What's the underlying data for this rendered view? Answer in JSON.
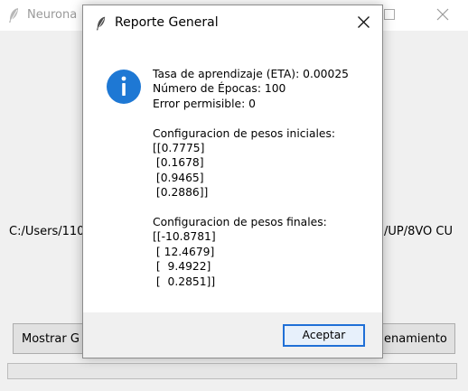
{
  "main_window": {
    "title": "Neurona",
    "path_left": "C:/Users/110",
    "path_right": "/UP/8VO CU",
    "btn_show_label": "Mostrar G",
    "btn_training_label": "enamiento",
    "progress": 0
  },
  "dialog": {
    "title": "Reporte General",
    "message": "Tasa de aprendizaje (ETA): 0.00025\nNúmero de Épocas: 100\nError permisible: 0\n\nConfiguracion de pesos iniciales:\n[[0.7775]\n [0.1678]\n [0.9465]\n [0.2886]]\n\nConfiguracion de pesos finales:\n[[-10.8781]\n [ 12.4679]\n [  9.4922]\n [  0.2851]]",
    "ok_label": "Aceptar"
  },
  "colors": {
    "accent": "#1f6fd6",
    "info_icon": "#1e78d4"
  },
  "icons": [
    "feather-icon",
    "info-icon",
    "close-icon",
    "maximize-icon"
  ]
}
